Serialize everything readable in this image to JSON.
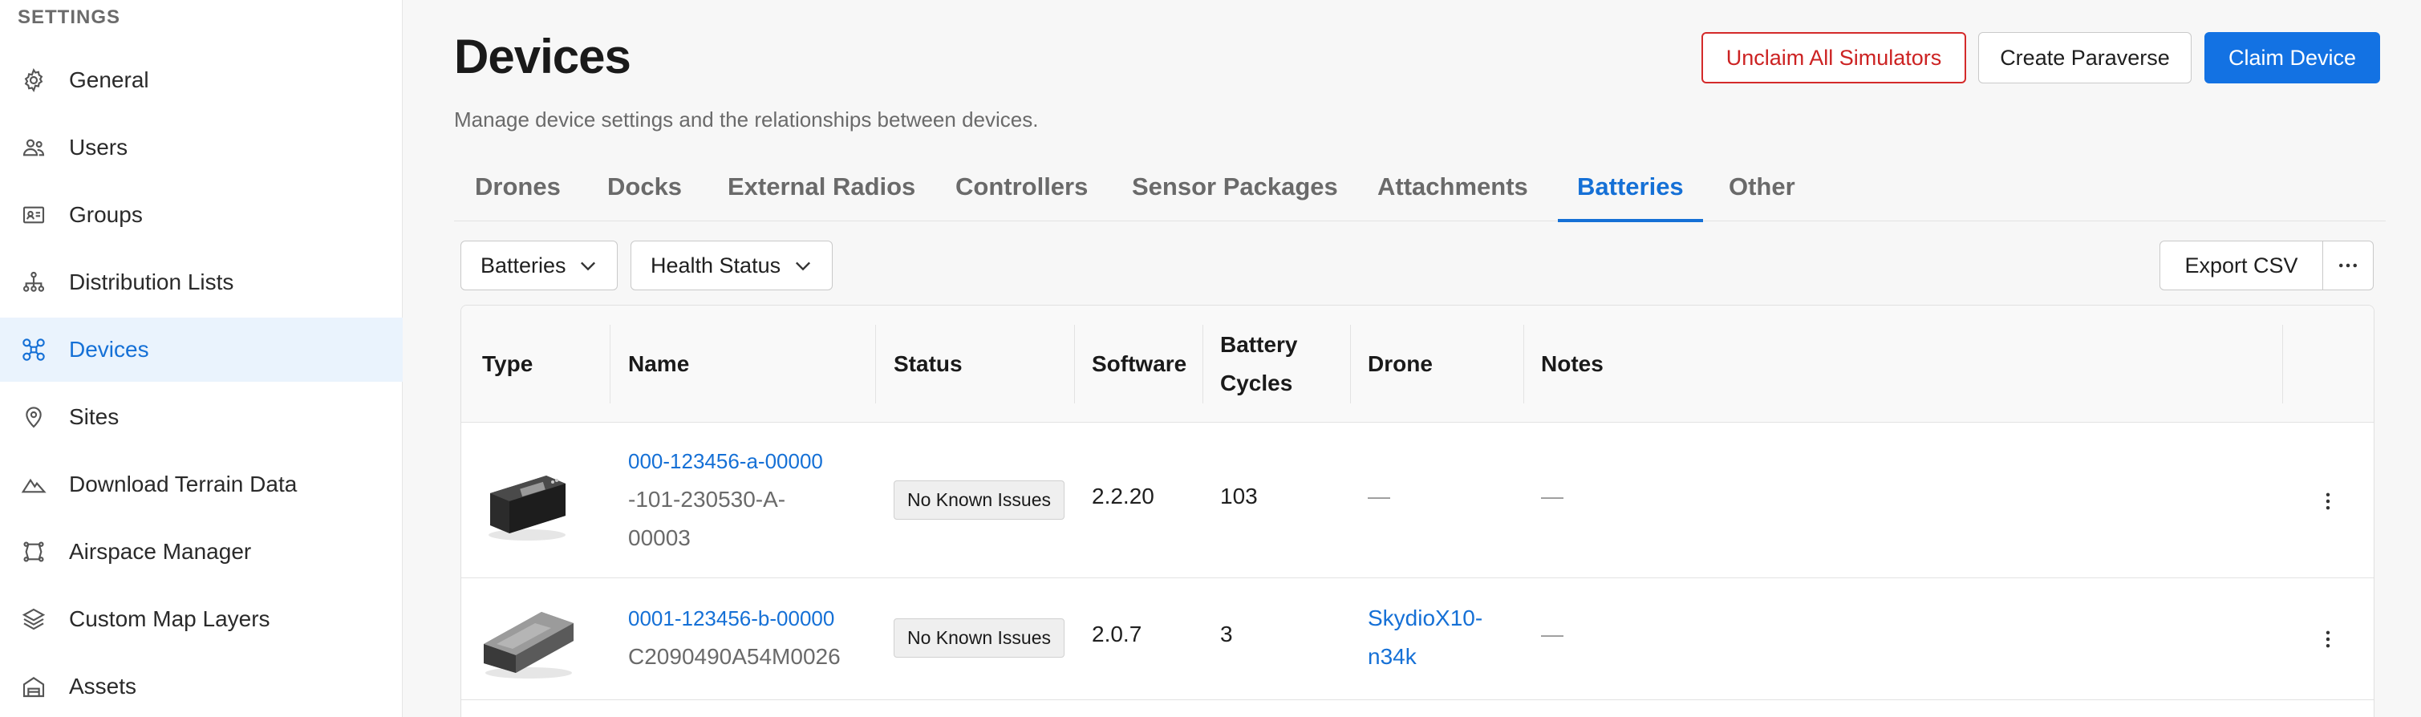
{
  "sidebar": {
    "heading": "SETTINGS",
    "items": [
      {
        "label": "General",
        "icon": "gear-icon"
      },
      {
        "label": "Users",
        "icon": "users-icon"
      },
      {
        "label": "Groups",
        "icon": "groups-icon"
      },
      {
        "label": "Distribution Lists",
        "icon": "hierarchy-icon"
      },
      {
        "label": "Devices",
        "icon": "drone-icon",
        "active": true
      },
      {
        "label": "Sites",
        "icon": "location-pin-icon"
      },
      {
        "label": "Download Terrain Data",
        "icon": "terrain-icon"
      },
      {
        "label": "Airspace Manager",
        "icon": "airspace-icon"
      },
      {
        "label": "Custom Map Layers",
        "icon": "layers-icon"
      },
      {
        "label": "Assets",
        "icon": "building-icon"
      }
    ]
  },
  "header": {
    "title": "Devices",
    "subtitle": "Manage device settings and the relationships between devices.",
    "unclaim_label": "Unclaim All Simulators",
    "create_label": "Create Paraverse",
    "claim_label": "Claim Device"
  },
  "tabs": [
    "Drones",
    "Docks",
    "External Radios",
    "Controllers",
    "Sensor Packages",
    "Attachments",
    "Batteries",
    "Other"
  ],
  "active_tab": "Batteries",
  "toolbar": {
    "filter_type": "Batteries",
    "filter_health": "Health Status",
    "export_label": "Export CSV"
  },
  "table": {
    "headers": {
      "type": "Type",
      "name": "Name",
      "status": "Status",
      "software": "Software",
      "battery_cycles_1": "Battery",
      "battery_cycles_2": "Cycles",
      "drone": "Drone",
      "notes": "Notes"
    },
    "rows": [
      {
        "name_link": "000-123456-a-00000",
        "name_line2": "-101-230530-A-",
        "name_line3": "00003",
        "status": "No Known Issues",
        "software": "2.2.20",
        "cycles": "103",
        "drone": "—",
        "notes": "—"
      },
      {
        "name_link": "0001-123456-b-00000",
        "name_line2": "C2090490A54M0026",
        "status": "No Known Issues",
        "software": "2.0.7",
        "cycles": "3",
        "drone_1": "SkydioX10-",
        "drone_2": "n34k",
        "notes": "—"
      }
    ]
  },
  "colors": {
    "accent": "#1570d6",
    "danger": "#cc2222",
    "primary_button": "#1372e3"
  }
}
